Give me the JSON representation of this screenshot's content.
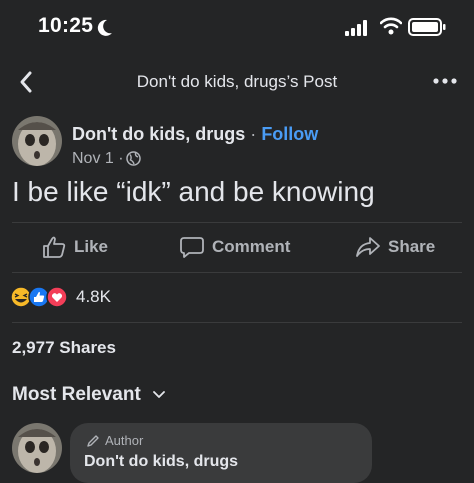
{
  "status_bar": {
    "time": "10:25"
  },
  "nav": {
    "title": "Don't do kids, drugs’s Post"
  },
  "post": {
    "author": "Don't do kids, drugs",
    "separator": "·",
    "follow_label": "Follow",
    "date": "Nov 1 ·",
    "text": "I be like “idk” and be knowing"
  },
  "actions": {
    "like": "Like",
    "comment": "Comment",
    "share": "Share"
  },
  "reactions": {
    "count": "4.8K",
    "types": [
      "haha",
      "like",
      "love"
    ]
  },
  "shares": "2,977 Shares",
  "comments": {
    "sort_label": "Most Relevant",
    "first": {
      "badge": "Author",
      "author": "Don't do kids, drugs"
    }
  },
  "colors": {
    "background": "#242526",
    "accent": "#4a9cf5",
    "muted": "#b0b3b8"
  }
}
